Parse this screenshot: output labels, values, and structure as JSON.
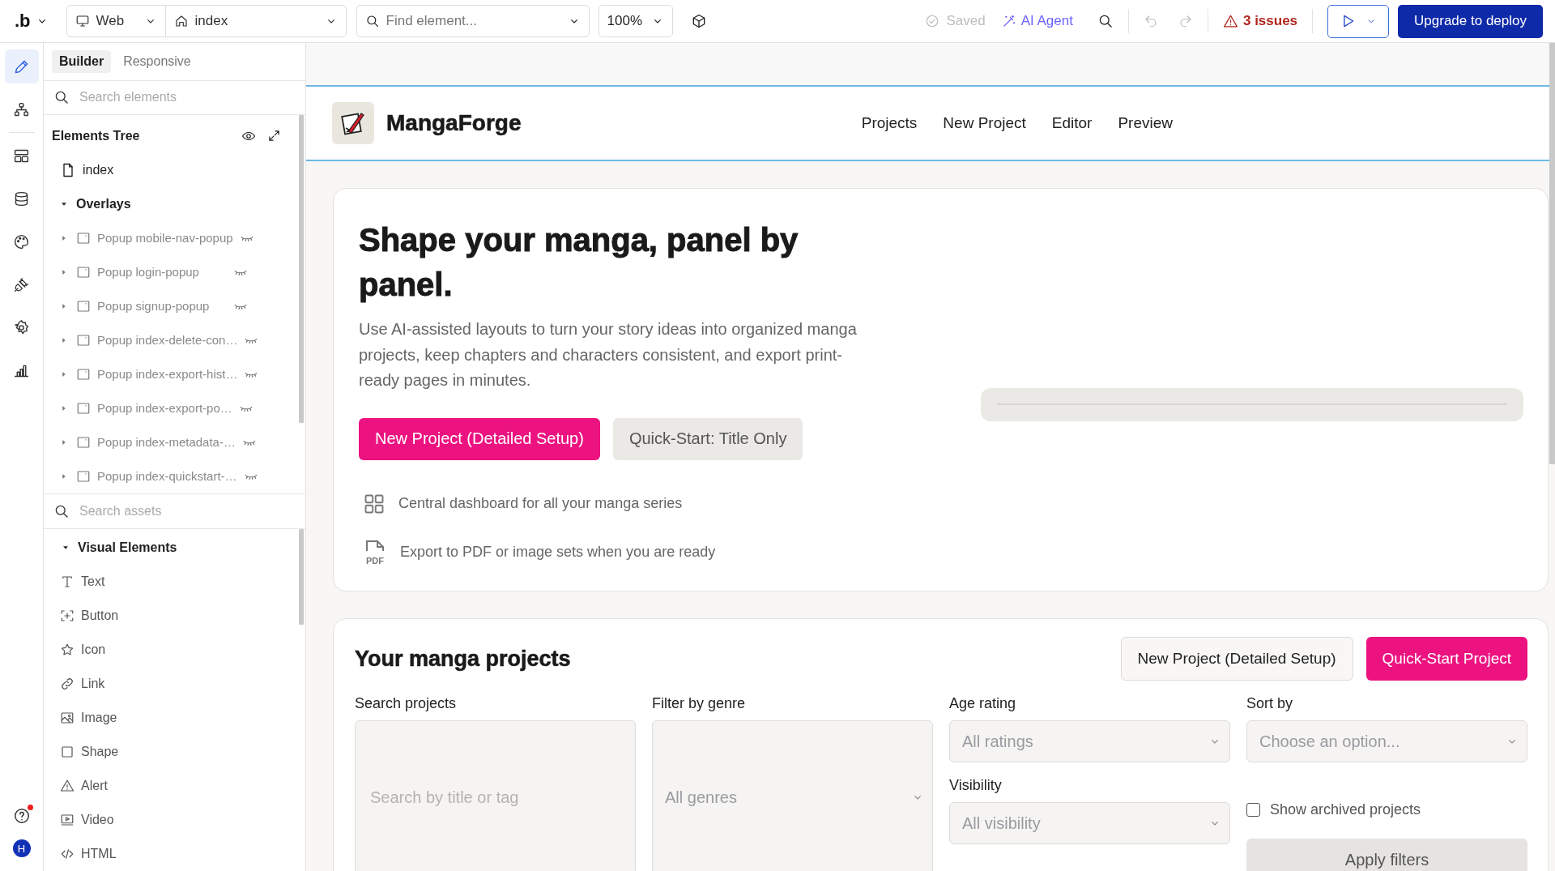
{
  "topbar": {
    "logo": ".b",
    "platform": "Web",
    "page": "index",
    "find_placeholder": "Find element...",
    "zoom": "100%",
    "saved": "Saved",
    "ai_agent": "AI Agent",
    "issues": "3 issues",
    "deploy": "Upgrade to deploy"
  },
  "rail": {
    "items": [
      {
        "kind": "pencil",
        "selected": true
      },
      {
        "kind": "hierarchy",
        "selected": false
      },
      {
        "kind": "layout",
        "selected": false
      },
      {
        "kind": "database",
        "selected": false
      },
      {
        "kind": "palette",
        "selected": false
      },
      {
        "kind": "plug",
        "selected": false
      },
      {
        "kind": "gear",
        "selected": false
      },
      {
        "kind": "chart",
        "selected": false
      }
    ],
    "help_notification": true,
    "avatar": "H"
  },
  "panel": {
    "tabs": [
      {
        "label": "Builder",
        "selected": true
      },
      {
        "label": "Responsive",
        "selected": false
      }
    ],
    "search_placeholder": "Search elements",
    "tree_title": "Elements Tree",
    "tree": [
      {
        "label": "index",
        "kind": "page"
      },
      {
        "label": "Overlays",
        "kind": "folder",
        "expanded": true,
        "children": [
          {
            "label": "Popup mobile-nav-popup",
            "kind": "popup",
            "expanded": false,
            "hidden": true
          },
          {
            "label": "Popup login-popup",
            "kind": "popup",
            "expanded": false,
            "hidden": true
          },
          {
            "label": "Popup signup-popup",
            "kind": "popup",
            "expanded": false,
            "hidden": true
          },
          {
            "label": "Popup index-delete-con…",
            "kind": "popup",
            "expanded": false,
            "hidden": true
          },
          {
            "label": "Popup index-export-hist…",
            "kind": "popup",
            "expanded": false,
            "hidden": true
          },
          {
            "label": "Popup index-export-po…",
            "kind": "popup",
            "expanded": false,
            "hidden": true
          },
          {
            "label": "Popup index-metadata-…",
            "kind": "popup",
            "expanded": false,
            "hidden": true
          },
          {
            "label": "Popup index-quickstart-…",
            "kind": "popup",
            "expanded": false,
            "hidden": true
          }
        ]
      }
    ],
    "assets_placeholder": "Search assets",
    "assets_group": {
      "label": "Visual Elements",
      "expanded": true,
      "items": [
        {
          "label": "Text",
          "kind": "text"
        },
        {
          "label": "Button",
          "kind": "button"
        },
        {
          "label": "Icon",
          "kind": "icon"
        },
        {
          "label": "Link",
          "kind": "link"
        },
        {
          "label": "Image",
          "kind": "image"
        },
        {
          "label": "Shape",
          "kind": "shape"
        },
        {
          "label": "Alert",
          "kind": "alert"
        },
        {
          "label": "Video",
          "kind": "video"
        },
        {
          "label": "HTML",
          "kind": "html"
        }
      ]
    }
  },
  "site": {
    "brand": "MangaForge",
    "nav": [
      "Projects",
      "New Project",
      "Editor",
      "Preview"
    ],
    "hero": {
      "title": "Shape your manga, panel by panel.",
      "text": "Use AI-assisted layouts to turn your story ideas into organized manga projects, keep chapters and characters consistent, and export print-ready pages in minutes.",
      "buttons": [
        {
          "label": "New Project (Detailed Setup)",
          "kind": "primary"
        },
        {
          "label": "Quick-Start: Title Only",
          "kind": "secondary"
        }
      ],
      "features": [
        {
          "kind": "grid",
          "text": "Central dashboard for all your manga series"
        },
        {
          "kind": "pdf",
          "icon_text": "PDF",
          "text": "Export to PDF or image sets when you are ready"
        }
      ]
    },
    "projects": {
      "title": "Your manga projects",
      "buttons": [
        {
          "label": "New Project (Detailed Setup)",
          "kind": "secondary"
        },
        {
          "label": "Quick-Start Project",
          "kind": "primary"
        }
      ],
      "filters": [
        {
          "kind": "search",
          "label": "Search projects",
          "placeholder": "Search by title or tag"
        },
        {
          "kind": "select",
          "label": "Filter by genre",
          "value": "All genres"
        },
        {
          "kind": "select",
          "label": "Age rating",
          "value": "All ratings"
        },
        {
          "kind": "select",
          "label": "Sort by",
          "value": "Choose an option..."
        },
        {
          "kind": "select",
          "label": "Visibility",
          "value": "All visibility"
        },
        {
          "kind": "checkbox",
          "label": "Show archived projects",
          "checked": false
        },
        {
          "kind": "button",
          "label": "Apply filters"
        }
      ]
    }
  }
}
